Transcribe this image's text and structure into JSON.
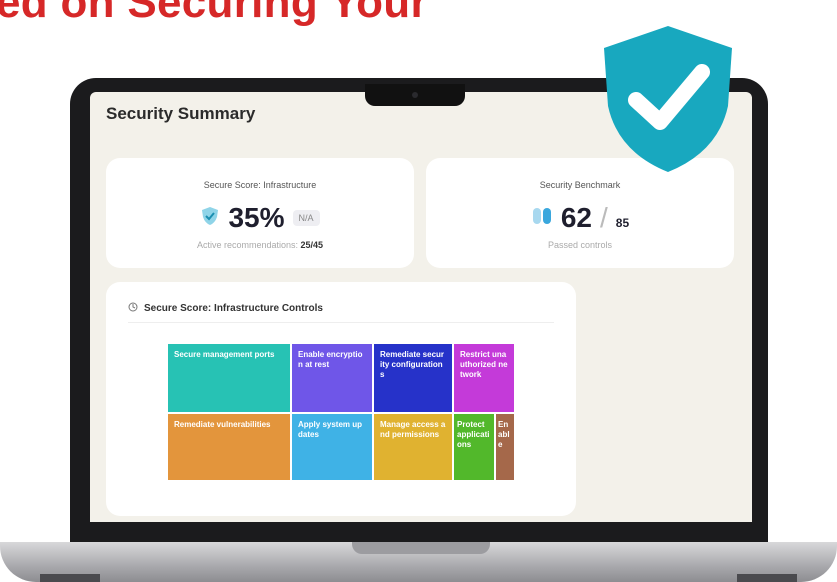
{
  "headline": "ed on Securing Your",
  "screen": {
    "title": "Security Summary",
    "card_secure_score": {
      "label": "Secure Score: Infrastructure",
      "value": "35%",
      "badge": "N/A",
      "active_label": "Active recommendations:",
      "active_value": "25/45"
    },
    "card_benchmark": {
      "label": "Security Benchmark",
      "value": "62",
      "total": "85",
      "sub": "Passed controls"
    },
    "controls": {
      "title": "Secure Score: Infrastructure Controls",
      "tiles": [
        {
          "label": "Secure management ports",
          "color": "#27c2b4"
        },
        {
          "label": "Enable encryption at rest",
          "color": "#6f56e8"
        },
        {
          "label": "Remediate security configurations",
          "color": "#2632c9"
        },
        {
          "label": "Restrict unauthorized network",
          "color": "#c43ad9"
        },
        {
          "label": "Remediate vulnerabilities",
          "color": "#e3953c"
        },
        {
          "label": "Apply system updates",
          "color": "#3fb2e6"
        },
        {
          "label": "Manage access and permissions",
          "color": "#e0b230"
        },
        {
          "label": "Protect applications",
          "color": "#52b82b"
        },
        {
          "label": "Enable",
          "color": "#a5684a"
        }
      ]
    }
  },
  "colors": {
    "headline": "#d62828",
    "shield": "#18a8bf",
    "screen_bg": "#f3f1ea"
  }
}
